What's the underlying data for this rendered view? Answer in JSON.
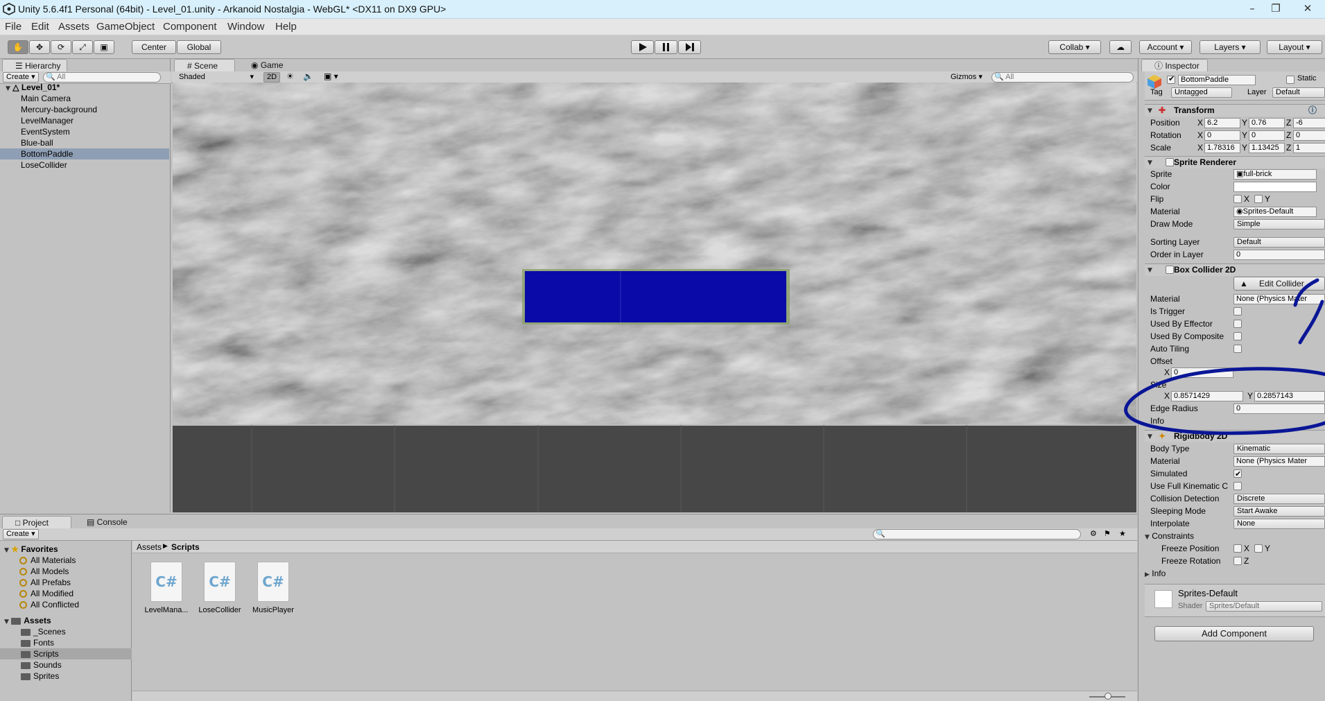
{
  "window": {
    "title": "Unity 5.6.4f1 Personal (64bit) - Level_01.unity - Arkanoid Nostalgia - WebGL* <DX11 on DX9 GPU>"
  },
  "menu": [
    "File",
    "Edit",
    "Assets",
    "GameObject",
    "Component",
    "Window",
    "Help"
  ],
  "toolbar": {
    "center": "Center",
    "global": "Global",
    "collab": "Collab",
    "account": "Account",
    "layers": "Layers",
    "layout": "Layout"
  },
  "hierarchy": {
    "tab": "Hierarchy",
    "create": "Create",
    "search": "All",
    "scene": "Level_01*",
    "items": [
      "Main Camera",
      "Mercury-background",
      "LevelManager",
      "EventSystem",
      "Blue-ball",
      "BottomPaddle",
      "LoseCollider"
    ],
    "selected_index": 5
  },
  "scene": {
    "tab_scene": "Scene",
    "tab_game": "Game",
    "shading": "Shaded",
    "mode_2d": "2D",
    "gizmos": "Gizmos",
    "search": "All",
    "paddle_color": "#0a0aa8"
  },
  "project": {
    "tab_project": "Project",
    "tab_console": "Console",
    "create": "Create",
    "favorites_label": "Favorites",
    "favorites": [
      "All Materials",
      "All Models",
      "All Prefabs",
      "All Modified",
      "All Conflicted"
    ],
    "assets_label": "Assets",
    "folders": [
      "_Scenes",
      "Fonts",
      "Scripts",
      "Sounds",
      "Sprites"
    ],
    "selected_folder": "Scripts",
    "breadcrumb_root": "Assets",
    "breadcrumb_current": "Scripts",
    "files": [
      "LevelMana...",
      "LoseCollider",
      "MusicPlayer"
    ],
    "file_icon_text": "C#"
  },
  "inspector": {
    "tab": "Inspector",
    "object_name": "BottomPaddle",
    "static_label": "Static",
    "tag_label": "Tag",
    "tag_value": "Untagged",
    "layer_label": "Layer",
    "layer_value": "Default",
    "transform": {
      "title": "Transform",
      "position_label": "Position",
      "rotation_label": "Rotation",
      "scale_label": "Scale",
      "pos": [
        "6.2",
        "0.76",
        "-6"
      ],
      "rot": [
        "0",
        "0",
        "0"
      ],
      "scale": [
        "1.78316",
        "1.13425",
        "1"
      ],
      "axes": [
        "X",
        "Y",
        "Z"
      ]
    },
    "sprite_renderer": {
      "title": "Sprite Renderer",
      "sprite_label": "Sprite",
      "sprite_value": "full-brick",
      "color_label": "Color",
      "flip_label": "Flip",
      "flip_x": "X",
      "flip_y": "Y",
      "material_label": "Material",
      "material_value": "Sprites-Default",
      "draw_mode_label": "Draw Mode",
      "draw_mode_value": "Simple",
      "sorting_label": "Sorting Layer",
      "sorting_value": "Default",
      "order_label": "Order in Layer",
      "order_value": "0"
    },
    "box_collider": {
      "title": "Box Collider 2D",
      "edit_collider": "Edit Collider",
      "material_label": "Material",
      "material_value": "None (Physics Mater",
      "is_trigger": "Is Trigger",
      "used_by_effector": "Used By Effector",
      "used_by_composite": "Used By Composite",
      "auto_tiling": "Auto Tiling",
      "offset_label": "Offset",
      "offset_x": "0",
      "size_label": "Size",
      "size_x": "0.8571429",
      "size_y": "0.2857143",
      "edge_radius_label": "Edge Radius",
      "edge_radius_value": "0",
      "info_label": "Info"
    },
    "rigidbody": {
      "title": "Rigidbody 2D",
      "body_type_label": "Body Type",
      "body_type_value": "Kinematic",
      "material_label": "Material",
      "material_value": "None (Physics Mater",
      "simulated_label": "Simulated",
      "full_kinematic_label": "Use Full Kinematic C",
      "collision_label": "Collision Detection",
      "collision_value": "Discrete",
      "sleeping_label": "Sleeping Mode",
      "sleeping_value": "Start Awake",
      "interpolate_label": "Interpolate",
      "interpolate_value": "None",
      "constraints_label": "Constraints",
      "freeze_position_label": "Freeze Position",
      "freeze_rotation_label": "Freeze Rotation",
      "info_label": "Info"
    },
    "material_preview": {
      "name": "Sprites-Default",
      "shader_label": "Shader",
      "shader_value": "Sprites/Default"
    },
    "add_component": "Add Component"
  }
}
